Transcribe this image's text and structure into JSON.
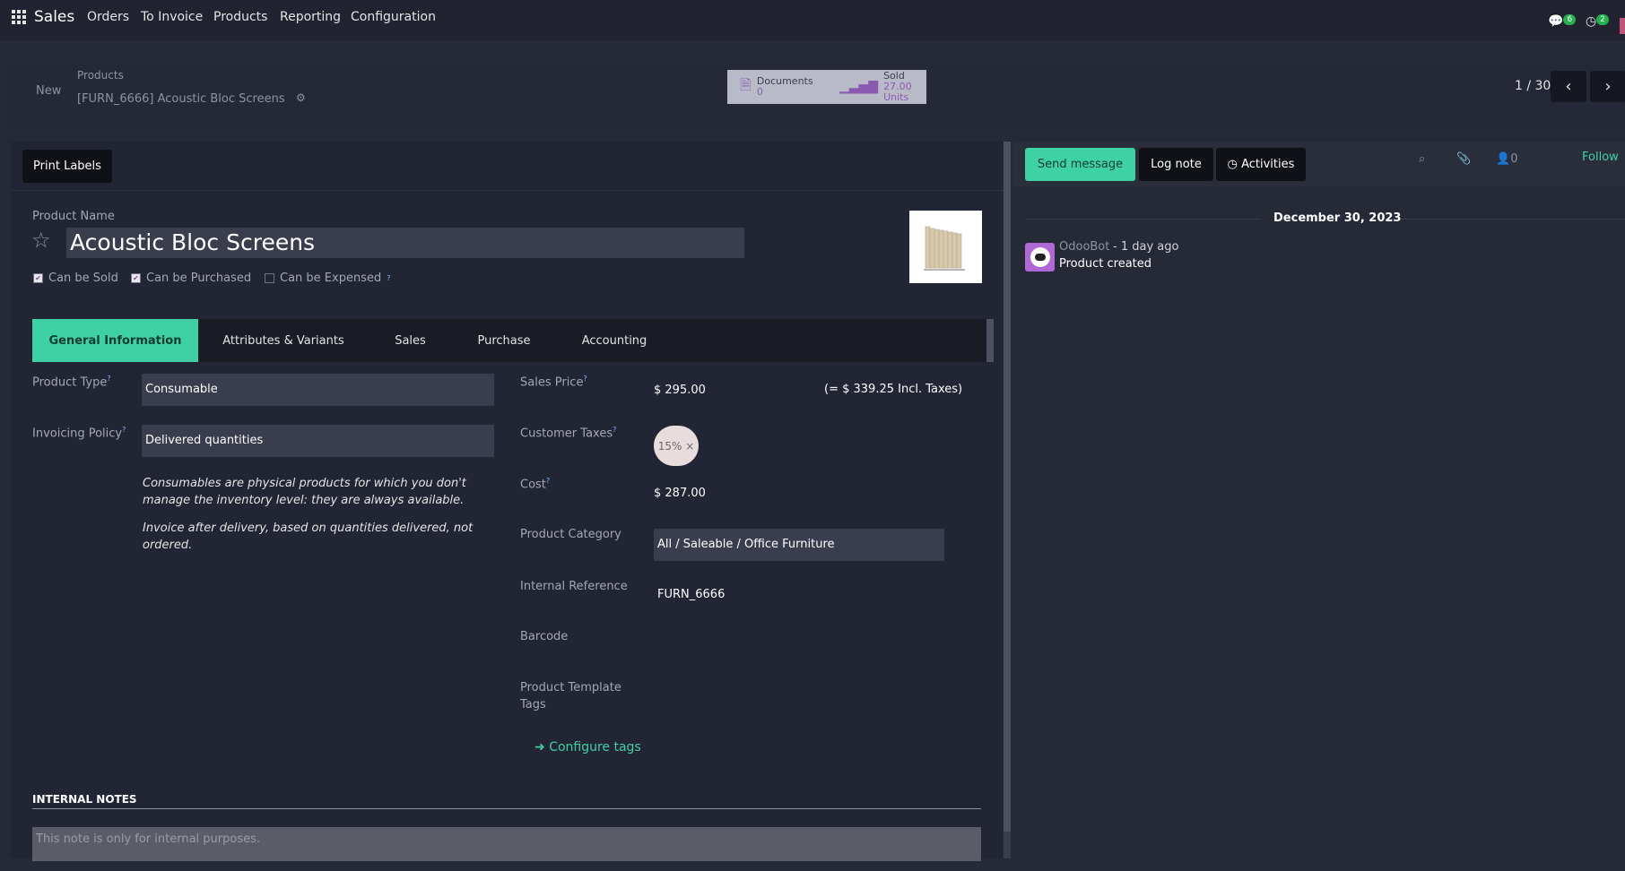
{
  "navbar": {
    "brand": "Sales",
    "items": [
      "Orders",
      "To Invoice",
      "Products",
      "Reporting",
      "Configuration"
    ],
    "messages_count": "6",
    "activities_count": "2"
  },
  "breadcrumb": {
    "new": "New",
    "parent": "Products",
    "current": "[FURN_6666] Acoustic Bloc Screens"
  },
  "smart_buttons": {
    "documents": {
      "label": "Documents",
      "value": "0"
    },
    "sold": {
      "label": "Sold",
      "value": "27.00 Units"
    }
  },
  "pager": {
    "text": "1 / 30"
  },
  "form": {
    "print_labels": "Print Labels",
    "product_name_label": "Product Name",
    "product_name": "Acoustic Bloc Screens",
    "checks": {
      "can_be_sold": {
        "label": "Can be Sold",
        "checked": true
      },
      "can_be_purchased": {
        "label": "Can be Purchased",
        "checked": true
      },
      "can_be_expensed": {
        "label": "Can be Expensed",
        "checked": false
      }
    },
    "tabs": [
      "General Information",
      "Attributes & Variants",
      "Sales",
      "Purchase",
      "Accounting"
    ],
    "left": {
      "product_type_label": "Product Type",
      "product_type": "Consumable",
      "invoicing_policy_label": "Invoicing Policy",
      "invoicing_policy": "Delivered quantities",
      "help1": "Consumables are physical products for which you don't manage the inventory level: they are always available.",
      "help2": "Invoice after delivery, based on quantities delivered, not ordered."
    },
    "right": {
      "sales_price_label": "Sales Price",
      "sales_price": "$ 295.00",
      "incl_taxes": "(= $ 339.25 Incl. Taxes)",
      "customer_taxes_label": "Customer Taxes",
      "tax_tag": "15% ×",
      "cost_label": "Cost",
      "cost": "$ 287.00",
      "product_category_label": "Product Category",
      "product_category": "All / Saleable / Office Furniture",
      "internal_reference_label": "Internal Reference",
      "internal_reference": "FURN_6666",
      "barcode_label": "Barcode",
      "template_tags_label_1": "Product Template",
      "template_tags_label_2": "Tags",
      "configure_tags": "Configure tags"
    },
    "internal_notes_title": "INTERNAL NOTES",
    "internal_notes_placeholder": "This note is only for internal purposes."
  },
  "chatter": {
    "send_message": "Send message",
    "log_note": "Log note",
    "activities": "Activities",
    "followers_count": "0",
    "follow": "Follow",
    "date": "December 30, 2023",
    "message": {
      "author": "OdooBot",
      "time": "- 1 day ago",
      "body": "Product created"
    }
  },
  "colors": {
    "accent": "#3ed1a4",
    "background": "#262a36",
    "input": "#3a3d4d"
  }
}
